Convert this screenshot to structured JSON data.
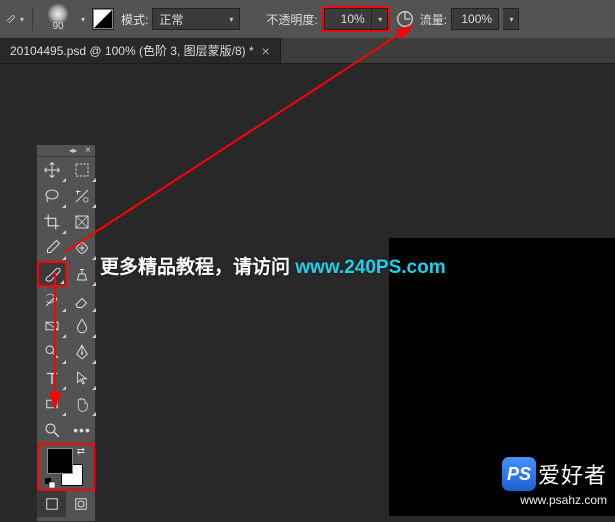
{
  "options": {
    "brush_size": "90",
    "mode_label": "模式:",
    "mode_value": "正常",
    "opacity_label": "不透明度:",
    "opacity_value": "10%",
    "flow_label": "流量:",
    "flow_value": "100%"
  },
  "tab": {
    "title": "20104495.psd @ 100% (色阶 3, 图层蒙版/8) *",
    "close": "×"
  },
  "overlay": {
    "lead": "更多精品教程，请访问 ",
    "url": "www.240PS.com"
  },
  "watermark": {
    "logo": "PS",
    "text": "爱好者",
    "url": "www.psahz.com"
  }
}
